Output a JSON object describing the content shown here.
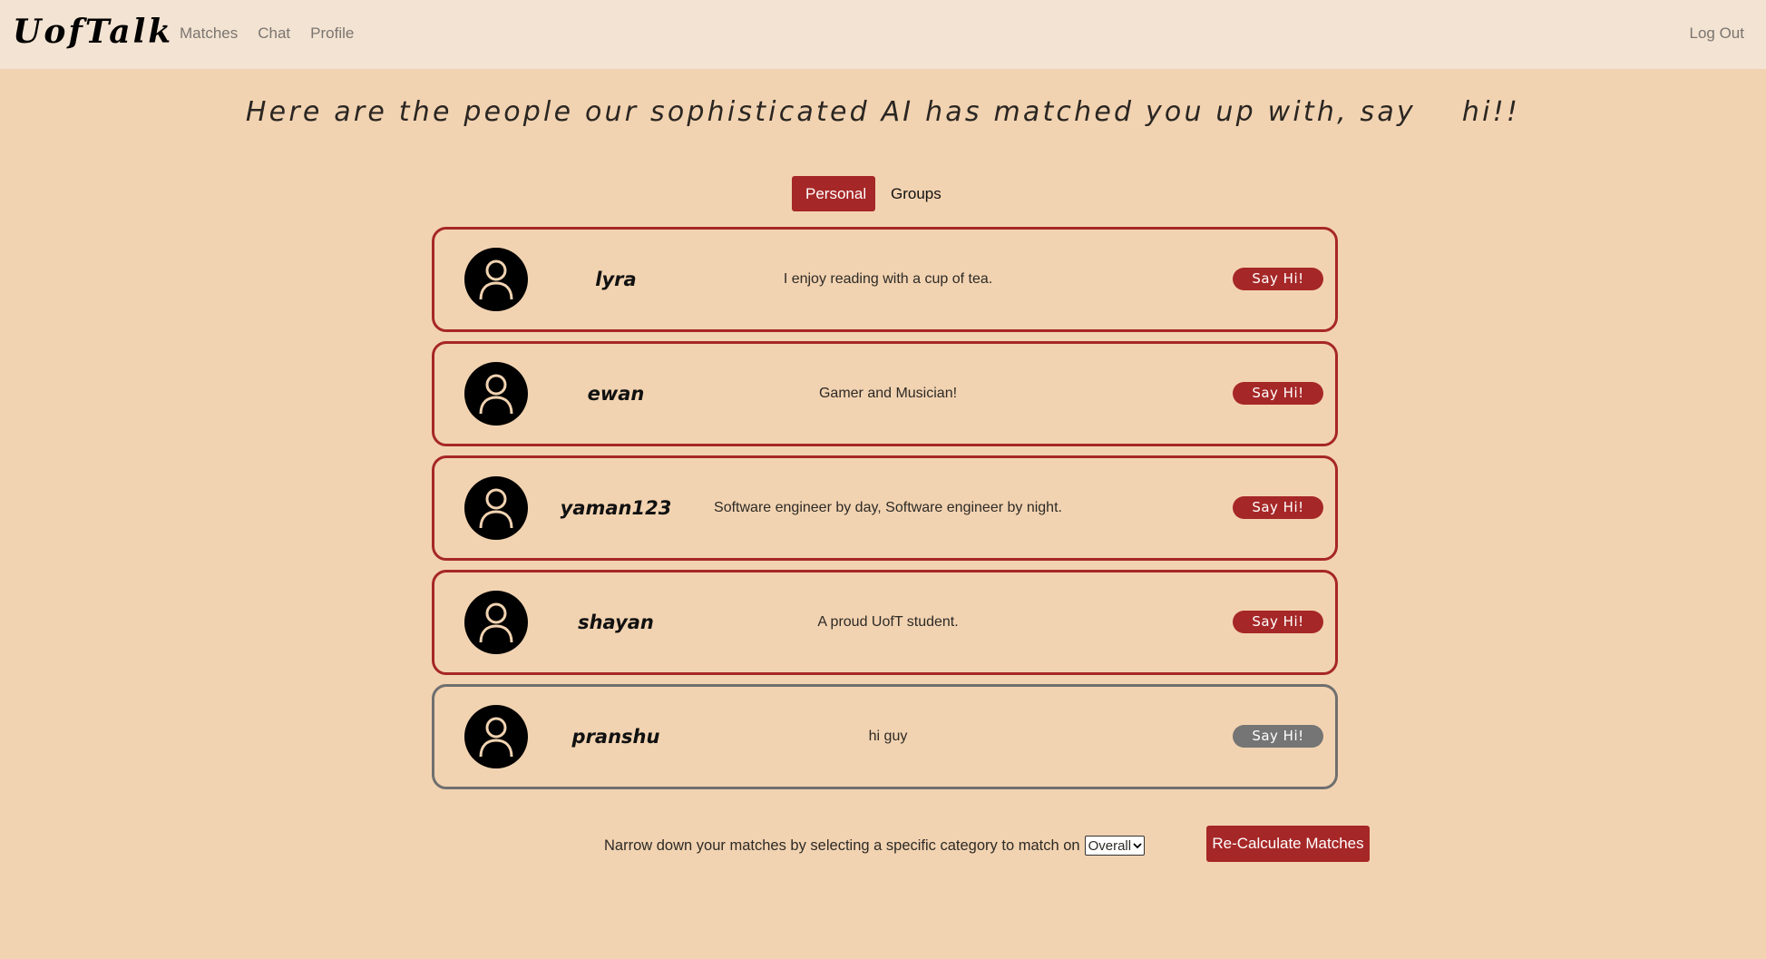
{
  "navbar": {
    "brand": "UofTalk",
    "links": [
      "Matches",
      "Chat",
      "Profile"
    ],
    "logout": "Log Out"
  },
  "headline": "Here are the people our sophisticated AI has matched you up with, say    hi!!",
  "tabs": {
    "personal": "Personal",
    "groups": "Groups",
    "active": "Personal"
  },
  "matches": [
    {
      "username": "lyra",
      "bio": "I enjoy reading with a cup of tea.",
      "button": "Say Hi!",
      "state": "active"
    },
    {
      "username": "ewan",
      "bio": "Gamer and Musician!",
      "button": "Say Hi!",
      "state": "active"
    },
    {
      "username": "yaman123",
      "bio": "Software engineer by day, Software engineer by night.",
      "button": "Say Hi!",
      "state": "active"
    },
    {
      "username": "shayan",
      "bio": "A proud UofT student.",
      "button": "Say Hi!",
      "state": "active"
    },
    {
      "username": "pranshu",
      "bio": "hi guy",
      "button": "Say Hi!",
      "state": "disabled"
    }
  ],
  "filter": {
    "label": "Narrow down your matches by selecting a specific category to match on",
    "selected": "Overall"
  },
  "recalculate_label": "Re-Calculate Matches",
  "colors": {
    "background": "#f2d3b1",
    "navbar": "#f3e3d2",
    "accent": "#a62727",
    "disabled": "#757575"
  },
  "icons": {
    "avatar": "user-icon",
    "select": "chevron-down-icon"
  }
}
